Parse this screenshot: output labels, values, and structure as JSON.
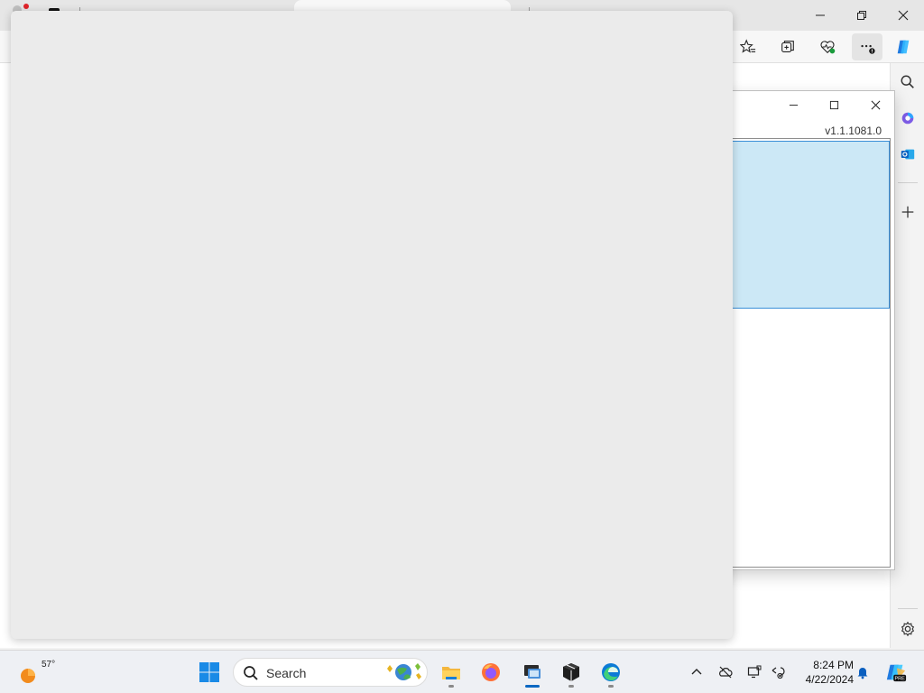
{
  "browser": {
    "window_controls": [
      "minimize",
      "restore",
      "close"
    ],
    "toolbar_icons": [
      "favorites-icon",
      "collections-icon",
      "browser-essentials-icon",
      "more-options-icon",
      "copilot-icon"
    ],
    "sidebar_icons": [
      "search-icon",
      "copilot-sidebar-icon",
      "outlook-icon",
      "add-icon",
      "settings-icon"
    ]
  },
  "app_window": {
    "version": "v1.1.1081.0",
    "window_controls": [
      "minimize",
      "maximize",
      "close"
    ],
    "selection_color": "#cce8f6"
  },
  "taskbar": {
    "weather_temp": "57°",
    "search_placeholder": "Search",
    "apps": [
      "start",
      "file-explorer",
      "firefox",
      "remote-desktop",
      "package-app",
      "edge"
    ],
    "clock_time": "8:24 PM",
    "clock_date": "4/22/2024",
    "accent": "#0a67c2"
  }
}
